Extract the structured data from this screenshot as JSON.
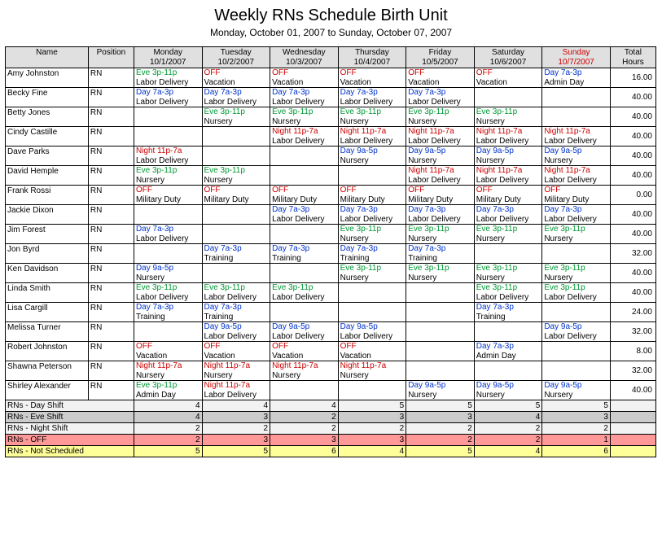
{
  "header": {
    "title": "Weekly RNs Schedule Birth Unit",
    "subtitle": "Monday, October 01, 2007 to Sunday, October 07, 2007"
  },
  "columns": {
    "name": "Name",
    "position": "Position",
    "days": [
      {
        "label": "Monday",
        "date": "10/1/2007",
        "sunday": false
      },
      {
        "label": "Tuesday",
        "date": "10/2/2007",
        "sunday": false
      },
      {
        "label": "Wednesday",
        "date": "10/3/2007",
        "sunday": false
      },
      {
        "label": "Thursday",
        "date": "10/4/2007",
        "sunday": false
      },
      {
        "label": "Friday",
        "date": "10/5/2007",
        "sunday": false
      },
      {
        "label": "Saturday",
        "date": "10/6/2007",
        "sunday": false
      },
      {
        "label": "Sunday",
        "date": "10/7/2007",
        "sunday": true
      }
    ],
    "total": "Total Hours"
  },
  "rows": [
    {
      "name": "Amy Johnston",
      "pos": "RN",
      "total": "16.00",
      "days": [
        {
          "shift": "Eve 3p-11p",
          "cls": "c-eve",
          "assign": "Labor Delivery"
        },
        {
          "shift": "OFF",
          "cls": "c-off",
          "assign": "Vacation"
        },
        {
          "shift": "OFF",
          "cls": "c-off",
          "assign": "Vacation"
        },
        {
          "shift": "OFF",
          "cls": "c-off",
          "assign": "Vacation"
        },
        {
          "shift": "OFF",
          "cls": "c-off",
          "assign": "Vacation"
        },
        {
          "shift": "OFF",
          "cls": "c-off",
          "assign": "Vacation"
        },
        {
          "shift": "Day 7a-3p",
          "cls": "c-day",
          "assign": "Admin Day"
        }
      ]
    },
    {
      "name": "Becky Fine",
      "pos": "RN",
      "total": "40.00",
      "days": [
        {
          "shift": "Day 7a-3p",
          "cls": "c-day",
          "assign": "Labor Delivery"
        },
        {
          "shift": "Day 7a-3p",
          "cls": "c-day",
          "assign": "Labor Delivery"
        },
        {
          "shift": "Day 7a-3p",
          "cls": "c-day",
          "assign": "Labor Delivery"
        },
        {
          "shift": "Day 7a-3p",
          "cls": "c-day",
          "assign": "Labor Delivery"
        },
        {
          "shift": "Day 7a-3p",
          "cls": "c-day",
          "assign": "Labor Delivery"
        },
        {
          "shift": "",
          "cls": "",
          "assign": ""
        },
        {
          "shift": "",
          "cls": "",
          "assign": ""
        }
      ]
    },
    {
      "name": "Betty Jones",
      "pos": "RN",
      "total": "40.00",
      "days": [
        {
          "shift": "",
          "cls": "",
          "assign": ""
        },
        {
          "shift": "Eve 3p-11p",
          "cls": "c-eve",
          "assign": "Nursery"
        },
        {
          "shift": "Eve 3p-11p",
          "cls": "c-eve",
          "assign": "Nursery"
        },
        {
          "shift": "Eve 3p-11p",
          "cls": "c-eve",
          "assign": "Nursery"
        },
        {
          "shift": "Eve 3p-11p",
          "cls": "c-eve",
          "assign": "Nursery"
        },
        {
          "shift": "Eve 3p-11p",
          "cls": "c-eve",
          "assign": "Nursery"
        },
        {
          "shift": "",
          "cls": "",
          "assign": ""
        }
      ]
    },
    {
      "name": "Cindy Castille",
      "pos": "RN",
      "total": "40.00",
      "days": [
        {
          "shift": "",
          "cls": "",
          "assign": ""
        },
        {
          "shift": "",
          "cls": "",
          "assign": ""
        },
        {
          "shift": "Night 11p-7a",
          "cls": "c-night",
          "assign": "Labor Delivery"
        },
        {
          "shift": "Night 11p-7a",
          "cls": "c-night",
          "assign": "Labor Delivery"
        },
        {
          "shift": "Night 11p-7a",
          "cls": "c-night",
          "assign": "Labor Delivery"
        },
        {
          "shift": "Night 11p-7a",
          "cls": "c-night",
          "assign": "Labor Delivery"
        },
        {
          "shift": "Night 11p-7a",
          "cls": "c-night",
          "assign": "Labor Delivery"
        }
      ]
    },
    {
      "name": "Dave Parks",
      "pos": "RN",
      "total": "40.00",
      "days": [
        {
          "shift": "Night 11p-7a",
          "cls": "c-night",
          "assign": "Labor Delivery"
        },
        {
          "shift": "",
          "cls": "",
          "assign": ""
        },
        {
          "shift": "",
          "cls": "",
          "assign": ""
        },
        {
          "shift": "Day 9a-5p",
          "cls": "c-day",
          "assign": "Nursery"
        },
        {
          "shift": "Day 9a-5p",
          "cls": "c-day",
          "assign": "Nursery"
        },
        {
          "shift": "Day 9a-5p",
          "cls": "c-day",
          "assign": "Nursery"
        },
        {
          "shift": "Day 9a-5p",
          "cls": "c-day",
          "assign": "Nursery"
        }
      ]
    },
    {
      "name": "David Hemple",
      "pos": "RN",
      "total": "40.00",
      "days": [
        {
          "shift": "Eve 3p-11p",
          "cls": "c-eve",
          "assign": "Nursery"
        },
        {
          "shift": "Eve 3p-11p",
          "cls": "c-eve",
          "assign": "Nursery"
        },
        {
          "shift": "",
          "cls": "",
          "assign": ""
        },
        {
          "shift": "",
          "cls": "",
          "assign": ""
        },
        {
          "shift": "Night 11p-7a",
          "cls": "c-night",
          "assign": "Labor Delivery"
        },
        {
          "shift": "Night 11p-7a",
          "cls": "c-night",
          "assign": "Labor Delivery"
        },
        {
          "shift": "Night 11p-7a",
          "cls": "c-night",
          "assign": "Labor Delivery"
        }
      ]
    },
    {
      "name": "Frank Rossi",
      "pos": "RN",
      "total": "0.00",
      "days": [
        {
          "shift": "OFF",
          "cls": "c-off",
          "assign": "Military Duty"
        },
        {
          "shift": "OFF",
          "cls": "c-off",
          "assign": "Military Duty"
        },
        {
          "shift": "OFF",
          "cls": "c-off",
          "assign": "Military Duty"
        },
        {
          "shift": "OFF",
          "cls": "c-off",
          "assign": "Military Duty"
        },
        {
          "shift": "OFF",
          "cls": "c-off",
          "assign": "Military Duty"
        },
        {
          "shift": "OFF",
          "cls": "c-off",
          "assign": "Military Duty"
        },
        {
          "shift": "OFF",
          "cls": "c-off",
          "assign": "Military Duty"
        }
      ]
    },
    {
      "name": "Jackie Dixon",
      "pos": "RN",
      "total": "40.00",
      "days": [
        {
          "shift": "",
          "cls": "",
          "assign": ""
        },
        {
          "shift": "",
          "cls": "",
          "assign": ""
        },
        {
          "shift": "Day 7a-3p",
          "cls": "c-day",
          "assign": "Labor Delivery"
        },
        {
          "shift": "Day 7a-3p",
          "cls": "c-day",
          "assign": "Labor Delivery"
        },
        {
          "shift": "Day 7a-3p",
          "cls": "c-day",
          "assign": "Labor Delivery"
        },
        {
          "shift": "Day 7a-3p",
          "cls": "c-day",
          "assign": "Labor Delivery"
        },
        {
          "shift": "Day 7a-3p",
          "cls": "c-day",
          "assign": "Labor Delivery"
        }
      ]
    },
    {
      "name": "Jim Forest",
      "pos": "RN",
      "total": "40.00",
      "days": [
        {
          "shift": "Day 7a-3p",
          "cls": "c-day",
          "assign": "Labor Delivery"
        },
        {
          "shift": "",
          "cls": "",
          "assign": ""
        },
        {
          "shift": "",
          "cls": "",
          "assign": ""
        },
        {
          "shift": "Eve 3p-11p",
          "cls": "c-eve",
          "assign": "Nursery"
        },
        {
          "shift": "Eve 3p-11p",
          "cls": "c-eve",
          "assign": "Nursery"
        },
        {
          "shift": "Eve 3p-11p",
          "cls": "c-eve",
          "assign": "Nursery"
        },
        {
          "shift": "Eve 3p-11p",
          "cls": "c-eve",
          "assign": "Nursery"
        }
      ]
    },
    {
      "name": "Jon Byrd",
      "pos": "RN",
      "total": "32.00",
      "days": [
        {
          "shift": "",
          "cls": "",
          "assign": ""
        },
        {
          "shift": "Day 7a-3p",
          "cls": "c-day",
          "assign": "Training"
        },
        {
          "shift": "Day 7a-3p",
          "cls": "c-day",
          "assign": "Training"
        },
        {
          "shift": "Day 7a-3p",
          "cls": "c-day",
          "assign": "Training"
        },
        {
          "shift": "Day 7a-3p",
          "cls": "c-day",
          "assign": "Training"
        },
        {
          "shift": "",
          "cls": "",
          "assign": ""
        },
        {
          "shift": "",
          "cls": "",
          "assign": ""
        }
      ]
    },
    {
      "name": "Ken Davidson",
      "pos": "RN",
      "total": "40.00",
      "days": [
        {
          "shift": "Day 9a-5p",
          "cls": "c-day",
          "assign": "Nursery"
        },
        {
          "shift": "",
          "cls": "",
          "assign": ""
        },
        {
          "shift": "",
          "cls": "",
          "assign": ""
        },
        {
          "shift": "Eve 3p-11p",
          "cls": "c-eve",
          "assign": "Nursery"
        },
        {
          "shift": "Eve 3p-11p",
          "cls": "c-eve",
          "assign": "Nursery"
        },
        {
          "shift": "Eve 3p-11p",
          "cls": "c-eve",
          "assign": "Nursery"
        },
        {
          "shift": "Eve 3p-11p",
          "cls": "c-eve",
          "assign": "Nursery"
        }
      ]
    },
    {
      "name": "Linda Smith",
      "pos": "RN",
      "total": "40.00",
      "days": [
        {
          "shift": "Eve 3p-11p",
          "cls": "c-eve",
          "assign": "Labor Delivery"
        },
        {
          "shift": "Eve 3p-11p",
          "cls": "c-eve",
          "assign": "Labor Delivery"
        },
        {
          "shift": "Eve 3p-11p",
          "cls": "c-eve",
          "assign": "Labor Delivery"
        },
        {
          "shift": "",
          "cls": "",
          "assign": ""
        },
        {
          "shift": "",
          "cls": "",
          "assign": ""
        },
        {
          "shift": "Eve 3p-11p",
          "cls": "c-eve",
          "assign": "Labor Delivery"
        },
        {
          "shift": "Eve 3p-11p",
          "cls": "c-eve",
          "assign": "Labor Delivery"
        }
      ]
    },
    {
      "name": "Lisa Cargill",
      "pos": "RN",
      "total": "24.00",
      "days": [
        {
          "shift": "Day 7a-3p",
          "cls": "c-day",
          "assign": "Training"
        },
        {
          "shift": "Day 7a-3p",
          "cls": "c-day",
          "assign": "Training"
        },
        {
          "shift": "",
          "cls": "",
          "assign": ""
        },
        {
          "shift": "",
          "cls": "",
          "assign": ""
        },
        {
          "shift": "",
          "cls": "",
          "assign": ""
        },
        {
          "shift": "Day 7a-3p",
          "cls": "c-day",
          "assign": "Training"
        },
        {
          "shift": "",
          "cls": "",
          "assign": ""
        }
      ]
    },
    {
      "name": "Melissa Turner",
      "pos": "RN",
      "total": "32.00",
      "days": [
        {
          "shift": "",
          "cls": "",
          "assign": ""
        },
        {
          "shift": "Day 9a-5p",
          "cls": "c-day",
          "assign": "Labor Delivery"
        },
        {
          "shift": "Day 9a-5p",
          "cls": "c-day",
          "assign": "Labor Delivery"
        },
        {
          "shift": "Day 9a-5p",
          "cls": "c-day",
          "assign": "Labor Delivery"
        },
        {
          "shift": "",
          "cls": "",
          "assign": ""
        },
        {
          "shift": "",
          "cls": "",
          "assign": ""
        },
        {
          "shift": "Day 9a-5p",
          "cls": "c-day",
          "assign": "Labor Delivery"
        }
      ]
    },
    {
      "name": "Robert Johnston",
      "pos": "RN",
      "total": "8.00",
      "days": [
        {
          "shift": "OFF",
          "cls": "c-off",
          "assign": "Vacation"
        },
        {
          "shift": "OFF",
          "cls": "c-off",
          "assign": "Vacation"
        },
        {
          "shift": "OFF",
          "cls": "c-off",
          "assign": "Vacation"
        },
        {
          "shift": "OFF",
          "cls": "c-off",
          "assign": "Vacation"
        },
        {
          "shift": "",
          "cls": "",
          "assign": ""
        },
        {
          "shift": "Day 7a-3p",
          "cls": "c-day",
          "assign": "Admin Day"
        },
        {
          "shift": "",
          "cls": "",
          "assign": ""
        }
      ]
    },
    {
      "name": "Shawna Peterson",
      "pos": "RN",
      "total": "32.00",
      "days": [
        {
          "shift": "Night 11p-7a",
          "cls": "c-night",
          "assign": "Nursery"
        },
        {
          "shift": "Night 11p-7a",
          "cls": "c-night",
          "assign": "Nursery"
        },
        {
          "shift": "Night 11p-7a",
          "cls": "c-night",
          "assign": "Nursery"
        },
        {
          "shift": "Night 11p-7a",
          "cls": "c-night",
          "assign": "Nursery"
        },
        {
          "shift": "",
          "cls": "",
          "assign": ""
        },
        {
          "shift": "",
          "cls": "",
          "assign": ""
        },
        {
          "shift": "",
          "cls": "",
          "assign": ""
        }
      ]
    },
    {
      "name": "Shirley Alexander",
      "pos": "RN",
      "total": "40.00",
      "days": [
        {
          "shift": "Eve 3p-11p",
          "cls": "c-eve",
          "assign": "Admin Day"
        },
        {
          "shift": "Night 11p-7a",
          "cls": "c-night",
          "assign": "Labor Delivery"
        },
        {
          "shift": "",
          "cls": "",
          "assign": ""
        },
        {
          "shift": "",
          "cls": "",
          "assign": ""
        },
        {
          "shift": "Day 9a-5p",
          "cls": "c-day",
          "assign": "Nursery"
        },
        {
          "shift": "Day 9a-5p",
          "cls": "c-day",
          "assign": "Nursery"
        },
        {
          "shift": "Day 9a-5p",
          "cls": "c-day",
          "assign": "Nursery"
        }
      ]
    }
  ],
  "summary": [
    {
      "label": "RNs - Day Shift",
      "cls": "sum-day",
      "vals": [
        "4",
        "4",
        "4",
        "5",
        "5",
        "5",
        "5",
        ""
      ]
    },
    {
      "label": "RNs - Eve Shift",
      "cls": "sum-eve",
      "vals": [
        "4",
        "3",
        "2",
        "3",
        "3",
        "4",
        "3",
        ""
      ]
    },
    {
      "label": "RNs - Night Shift",
      "cls": "sum-night",
      "vals": [
        "2",
        "2",
        "2",
        "2",
        "2",
        "2",
        "2",
        ""
      ]
    },
    {
      "label": "RNs - OFF",
      "cls": "sum-off",
      "vals": [
        "2",
        "3",
        "3",
        "3",
        "2",
        "2",
        "1",
        ""
      ]
    },
    {
      "label": "RNs - Not Scheduled",
      "cls": "sum-not",
      "vals": [
        "5",
        "5",
        "6",
        "4",
        "5",
        "4",
        "6",
        ""
      ]
    }
  ]
}
